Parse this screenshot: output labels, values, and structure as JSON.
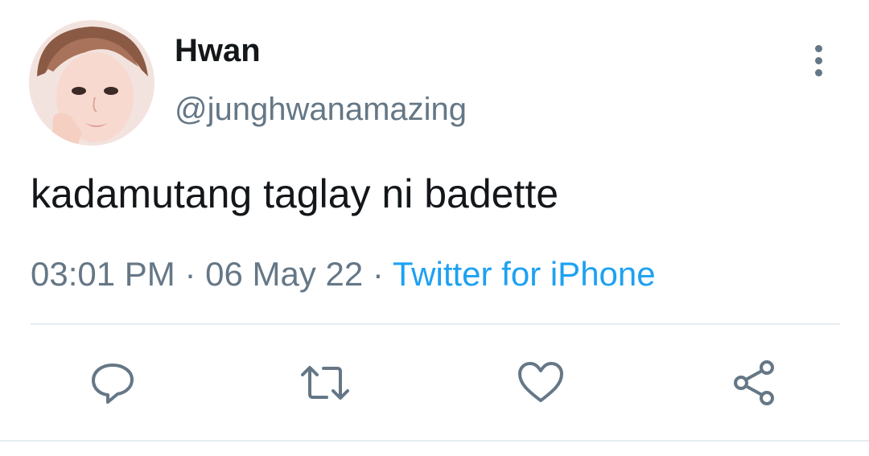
{
  "tweet": {
    "display_name": "Hwan",
    "handle": "@junghwanamazing",
    "text": "kadamutang taglay ni badette",
    "time": "03:01 PM",
    "separator": "·",
    "date": "06 May 22",
    "source": "Twitter for iPhone"
  },
  "icons": {
    "more": "more-vertical-icon",
    "reply": "reply-icon",
    "retweet": "retweet-icon",
    "like": "heart-icon",
    "share": "share-icon"
  },
  "colors": {
    "text_primary": "#14171a",
    "text_secondary": "#657786",
    "link": "#1da1f2",
    "divider": "#e6ecf0"
  }
}
